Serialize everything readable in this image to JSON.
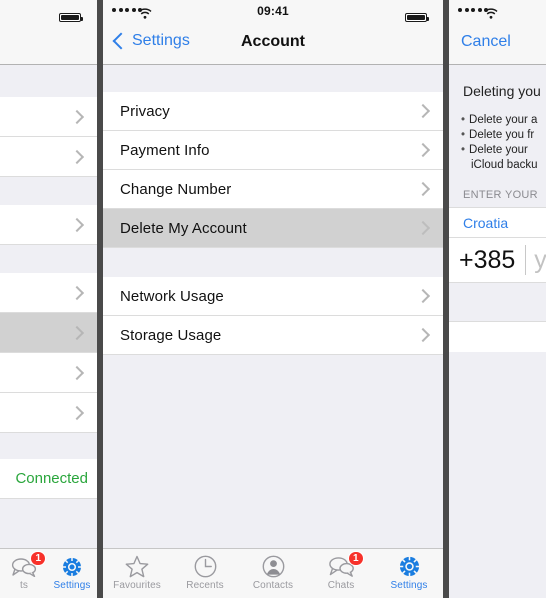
{
  "status_bar": {
    "signal_dots": 5,
    "wifi_icon": "wifi-icon",
    "time": "09:41",
    "battery_icon": "battery-icon"
  },
  "left_phone": {
    "rows": [
      {
        "label": "",
        "selected": false
      },
      {
        "label": "",
        "selected": false
      },
      {
        "label": "",
        "selected": false
      },
      {
        "label": "",
        "selected": false
      },
      {
        "label": "",
        "selected": true
      },
      {
        "label": "",
        "selected": false
      },
      {
        "label": "",
        "selected": false
      }
    ],
    "connected_label": "Connected",
    "tabs": [
      {
        "label": "ts",
        "icon": "chats-icon",
        "badge": "1",
        "active": false
      },
      {
        "label": "Settings",
        "icon": "gear-icon",
        "badge": "",
        "active": true
      }
    ]
  },
  "middle_phone": {
    "nav": {
      "back_label": "Settings",
      "back_icon": "chevron-left-icon",
      "title": "Account"
    },
    "group_one": [
      {
        "label": "Privacy",
        "selected": false
      },
      {
        "label": "Payment Info",
        "selected": false
      },
      {
        "label": "Change Number",
        "selected": false
      },
      {
        "label": "Delete My Account",
        "selected": true
      }
    ],
    "group_two": [
      {
        "label": "Network Usage",
        "selected": false
      },
      {
        "label": "Storage Usage",
        "selected": false
      }
    ],
    "tabs": [
      {
        "label": "Favourites",
        "icon": "star-icon",
        "badge": "",
        "active": false
      },
      {
        "label": "Recents",
        "icon": "clock-icon",
        "badge": "",
        "active": false
      },
      {
        "label": "Contacts",
        "icon": "person-icon",
        "badge": "",
        "active": false
      },
      {
        "label": "Chats",
        "icon": "chats-icon",
        "badge": "1",
        "active": false
      },
      {
        "label": "Settings",
        "icon": "gear-icon",
        "badge": "",
        "active": true
      }
    ]
  },
  "right_phone": {
    "nav": {
      "cancel_label": "Cancel"
    },
    "heading": "Deleting you",
    "bullets": [
      {
        "bullet": "•",
        "text": "Delete your a"
      },
      {
        "bullet": "•",
        "text": "Delete you fr"
      },
      {
        "bullet": "•",
        "text": "Delete your ",
        "continuation": "iCloud backu"
      }
    ],
    "section_header": "ENTER YOUR",
    "country": "Croatia",
    "country_code": "+385",
    "phone_placeholder": "y"
  },
  "colors": {
    "accent_blue": "#2f7fe8",
    "badge_red": "#f7312a",
    "connected_green": "#2aa63c",
    "group_background": "#efeff4",
    "row_background": "#ffffff",
    "selected_row": "#d1d1d1",
    "bezel": "#4a4a4a"
  }
}
